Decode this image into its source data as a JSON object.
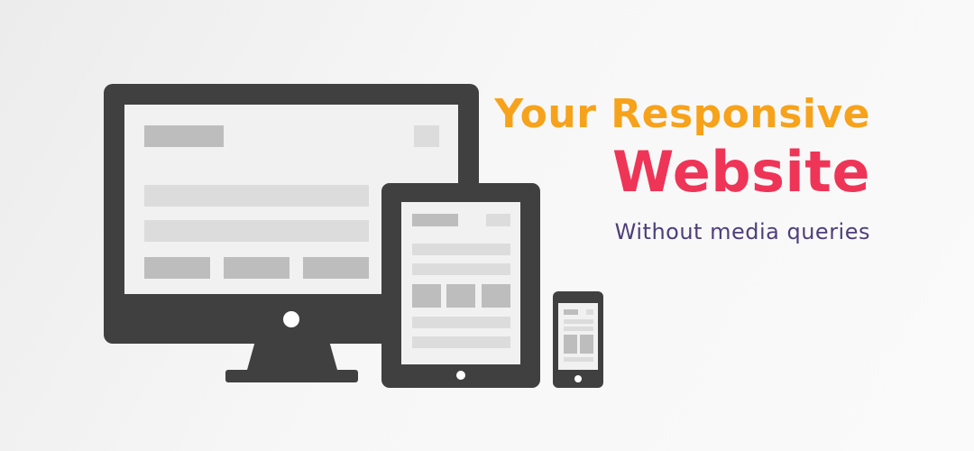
{
  "headline": {
    "line1": "Your Responsive",
    "line2": "Website",
    "tagline": "Without media queries"
  },
  "colors": {
    "line1": "#F7A21B",
    "line2": "#EE3557",
    "tagline": "#4E3F7A",
    "device_frame": "#404040",
    "screen": "#F1F1F1",
    "block": "#BDBDBD",
    "block_light": "#DCDCDD",
    "button": "#FFFFFF"
  },
  "icons": {
    "desktop": "desktop-monitor-icon",
    "tablet": "tablet-icon",
    "phone": "phone-icon"
  }
}
